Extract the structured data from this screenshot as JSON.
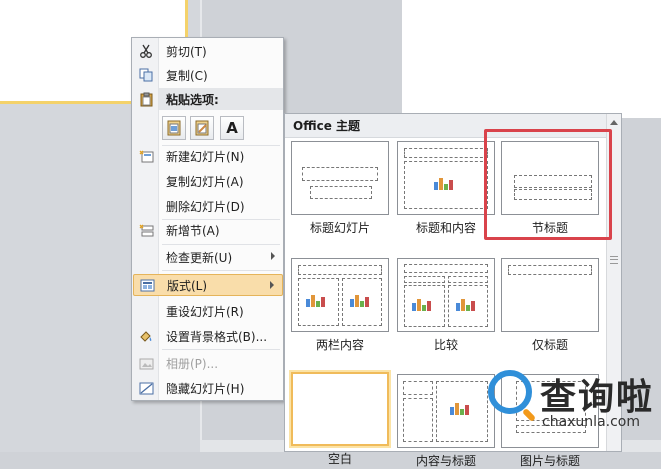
{
  "context_menu": {
    "items": [
      {
        "label": "剪切(T)",
        "icon": "scissors-icon"
      },
      {
        "label": "复制(C)",
        "icon": "copy-icon"
      },
      {
        "label": "粘贴选项:",
        "icon": "clipboard-icon"
      },
      {
        "label": "新建幻灯片(N)",
        "icon": "new-slide-icon"
      },
      {
        "label": "复制幻灯片(A)"
      },
      {
        "label": "删除幻灯片(D)"
      },
      {
        "label": "新增节(A)",
        "icon": "new-section-icon"
      },
      {
        "label": "检查更新(U)"
      },
      {
        "label": "版式(L)",
        "icon": "layout-icon",
        "active": true
      },
      {
        "label": "重设幻灯片(R)"
      },
      {
        "label": "设置背景格式(B)...",
        "icon": "format-background-icon"
      },
      {
        "label": "相册(P)...",
        "icon": "photo-album-icon",
        "disabled": true
      },
      {
        "label": "隐藏幻灯片(H)",
        "icon": "hide-slide-icon"
      }
    ],
    "paste_options": [
      "use-destination-theme-icon",
      "keep-source-formatting-icon",
      "keep-text-only-icon"
    ],
    "paste_text_glyph": "A"
  },
  "layout_panel": {
    "header": "Office 主题",
    "layouts": [
      {
        "caption": "标题幻灯片"
      },
      {
        "caption": "标题和内容"
      },
      {
        "caption": "节标题"
      },
      {
        "caption": "两栏内容"
      },
      {
        "caption": "比较"
      },
      {
        "caption": "仅标题"
      },
      {
        "caption": "空白",
        "selected": true
      },
      {
        "caption": "内容与标题"
      },
      {
        "caption": "图片与标题"
      }
    ]
  },
  "watermark": {
    "title": "查询啦",
    "domain": "chaxunla.com"
  },
  "colors": {
    "highlight_border": "#d9434b",
    "active_item": "#f9ddaa",
    "selected_frame": "#f0bb5a",
    "logo_blue": "#2f8fd9",
    "logo_orange": "#f29a1b"
  }
}
